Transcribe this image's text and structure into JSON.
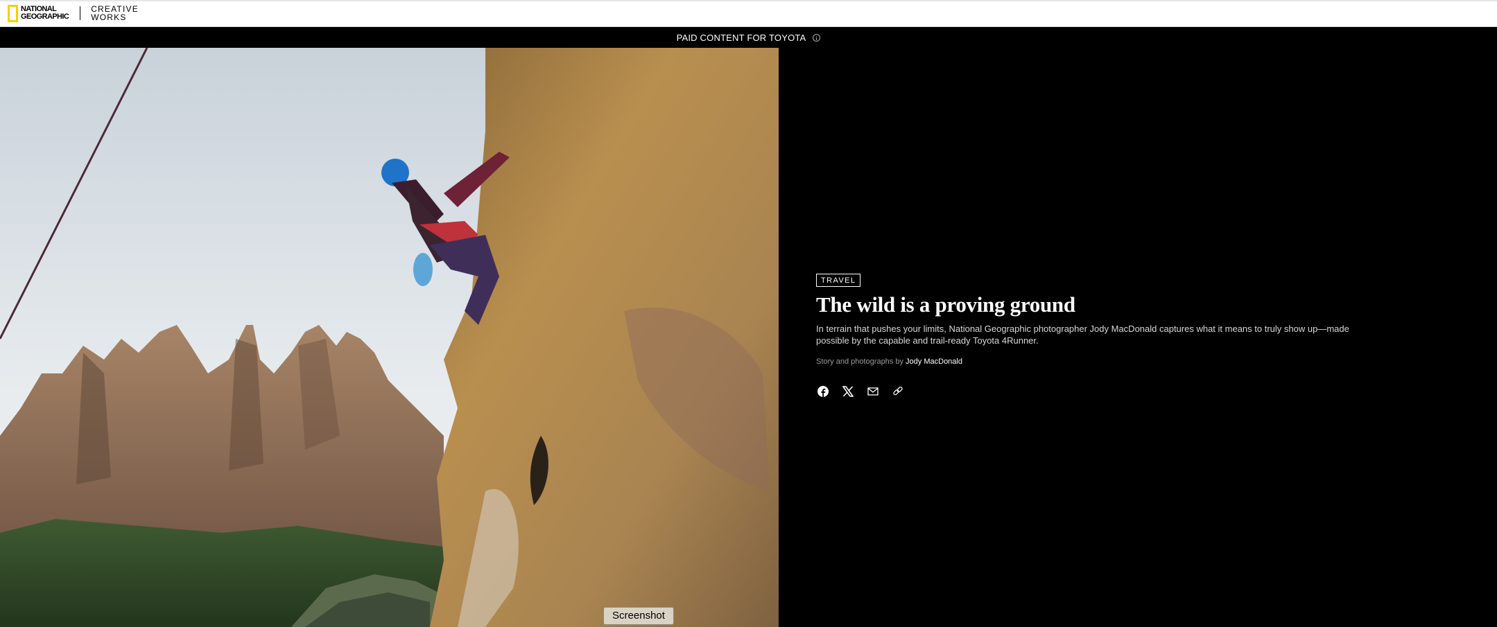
{
  "header": {
    "logo": {
      "line1": "NATIONAL",
      "line2": "GEOGRAPHIC",
      "cw_line1": "CREATIVE",
      "cw_line2": "WORKS"
    },
    "paid_notice": "PAID CONTENT FOR TOYOTA",
    "info_icon": "info-icon"
  },
  "hero_image": {
    "alt": "Rock climber in a blue helmet scaling a sunlit cliff above a river canyon"
  },
  "article": {
    "category": "TRAVEL",
    "title": "The wild is a proving ground",
    "dek": "In terrain that pushes your limits, National Geographic photographer Jody MacDonald captures what it means to truly show up—made possible by the capable and trail-ready Toyota 4Runner.",
    "byline_prefix": "Story and photographs by",
    "author": "Jody MacDonald",
    "share_icons": [
      "facebook-icon",
      "x-icon",
      "email-icon",
      "link-icon"
    ]
  },
  "overlay": {
    "screenshot_button": "Screenshot"
  }
}
